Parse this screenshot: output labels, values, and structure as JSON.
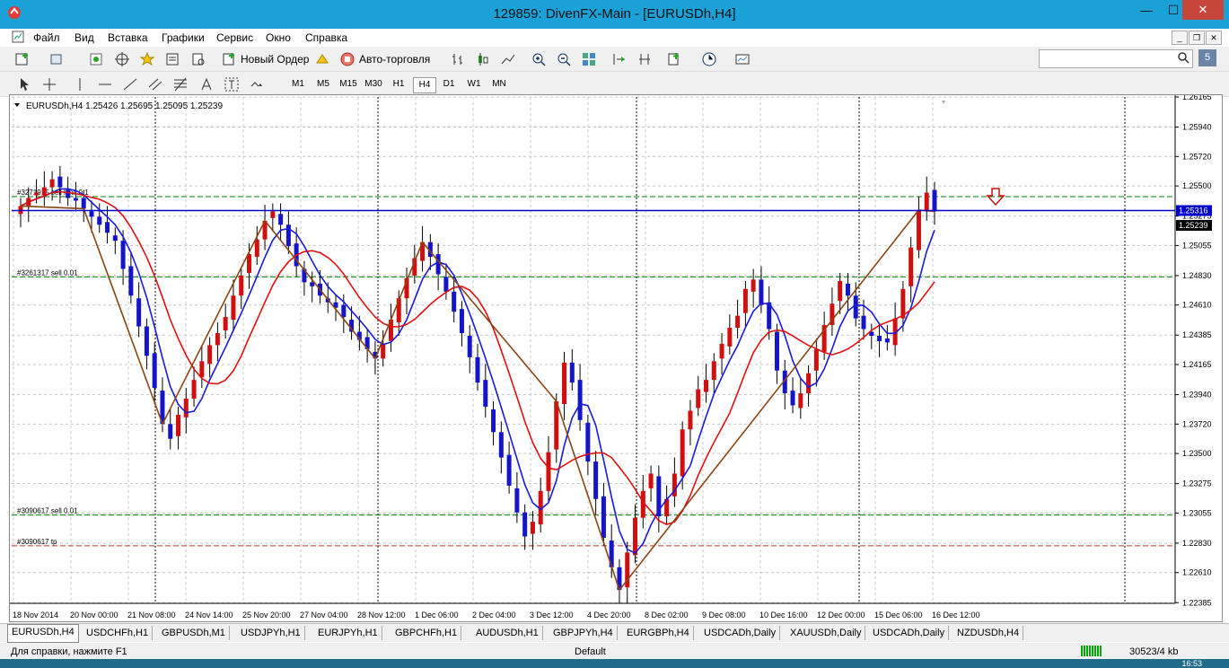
{
  "window": {
    "title": "129859: DivenFX-Main - [EURUSDh,H4]",
    "minimize": "—",
    "maximize": "☐",
    "close": "✕"
  },
  "menu": [
    "Файл",
    "Вид",
    "Вставка",
    "Графики",
    "Сервис",
    "Окно",
    "Справка"
  ],
  "toolbar1": {
    "new_order": "Новый Ордер",
    "autotrade": "Авто-торговля"
  },
  "timeframes": [
    "M1",
    "M5",
    "M15",
    "M30",
    "H1",
    "H4",
    "D1",
    "W1",
    "MN"
  ],
  "active_timeframe": "H4",
  "chart": {
    "header": "EURUSDh,H4  1.25426 1.25695 1.25095 1.25239",
    "bid_label": "1.25316",
    "ask_label": "1.25239",
    "order_lines": [
      {
        "text": "#3271915 sell limit 0.1",
        "price": 1.2542,
        "color": "#008000"
      },
      {
        "text": "#3261317 sell 0.01",
        "price": 1.2482,
        "color": "#008000"
      },
      {
        "text": "#3090617 sell 0.01",
        "price": 1.2304,
        "color": "#008000"
      },
      {
        "text": "#3090617 tp",
        "price": 1.2281,
        "color": "#c0392b"
      }
    ],
    "colors": {
      "bull": "#d10f0f",
      "bear": "#1414c8",
      "ma_fast": "#1a1ad8",
      "ma_slow": "#e01010",
      "zigzag": "#8b4513",
      "price_line": "#0000cc",
      "grid": "#c8c8c8"
    }
  },
  "chart_data": {
    "type": "candlestick",
    "symbol": "EURUSDh",
    "timeframe": "H4",
    "ylim": [
      1.2238,
      1.26165
    ],
    "y_ticks": [
      "1.26165",
      "1.25940",
      "1.25720",
      "1.25500",
      "1.25275",
      "1.25055",
      "1.24830",
      "1.24610",
      "1.24385",
      "1.24165",
      "1.23940",
      "1.23720",
      "1.23500",
      "1.23275",
      "1.23055",
      "1.22830",
      "1.22610",
      "1.22385"
    ],
    "x_labels": [
      "18 Nov 2014",
      "20 Nov 00:00",
      "21 Nov 08:00",
      "24 Nov 14:00",
      "25 Nov 20:00",
      "27 Nov 04:00",
      "28 Nov 12:00",
      "1 Dec 06:00",
      "2 Dec 04:00",
      "3 Dec 12:00",
      "4 Dec 20:00",
      "8 Dec 02:00",
      "9 Dec 08:00",
      "10 Dec 16:00",
      "12 Dec 00:00",
      "15 Dec 06:00",
      "16 Dec 12:00"
    ],
    "closes": [
      1.2535,
      1.2541,
      1.2545,
      1.2549,
      1.2555,
      1.2549,
      1.2541,
      1.2539,
      1.2533,
      1.2527,
      1.2521,
      1.2515,
      1.2509,
      1.2488,
      1.2468,
      1.2445,
      1.2423,
      1.2399,
      1.2372,
      1.2361,
      1.2379,
      1.2391,
      1.2405,
      1.2419,
      1.2431,
      1.244,
      1.2452,
      1.2468,
      1.2483,
      1.2499,
      1.251,
      1.2524,
      1.2531,
      1.2521,
      1.2505,
      1.249,
      1.2478,
      1.2475,
      1.2468,
      1.2463,
      1.2459,
      1.2452,
      1.2441,
      1.2435,
      1.2428,
      1.2421,
      1.2432,
      1.245,
      1.2466,
      1.2481,
      1.2496,
      1.2508,
      1.2497,
      1.2484,
      1.2471,
      1.2456,
      1.244,
      1.2422,
      1.2403,
      1.2385,
      1.2366,
      1.2347,
      1.2326,
      1.2306,
      1.2288,
      1.2299,
      1.2322,
      1.2351,
      1.2389,
      1.2418,
      1.2403,
      1.2375,
      1.2344,
      1.2316,
      1.2287,
      1.2265,
      1.2248,
      1.2276,
      1.2302,
      1.2322,
      1.2335,
      1.2303,
      1.2316,
      1.2335,
      1.2368,
      1.2382,
      1.2398,
      1.2405,
      1.2419,
      1.2432,
      1.2444,
      1.2453,
      1.2473,
      1.248,
      1.2461,
      1.2443,
      1.2412,
      1.2395,
      1.2386,
      1.2395,
      1.241,
      1.2428,
      1.2446,
      1.2462,
      1.2479,
      1.2468,
      1.2451,
      1.2443,
      1.2438,
      1.2434,
      1.2433,
      1.2451,
      1.2473,
      1.2504,
      1.2532,
      1.2545,
      1.2531
    ]
  },
  "tabs": [
    "EURUSDh,H4",
    "USDCHFh,H1",
    "GBPUSDh,M1",
    "USDJPYh,H1",
    "EURJPYh,H1",
    "GBPCHFh,H1",
    "AUDUSDh,H1",
    "GBPJPYh,H4",
    "EURGBPh,H4",
    "USDCADh,Daily",
    "XAUUSDh,Daily",
    "USDCADh,Daily",
    "NZDUSDh,H4"
  ],
  "active_tab": "EURUSDh,H4",
  "status": {
    "help": "Для справки, нажмите F1",
    "profile": "Default",
    "traffic": "30523/4 kb",
    "time": "16:53"
  }
}
